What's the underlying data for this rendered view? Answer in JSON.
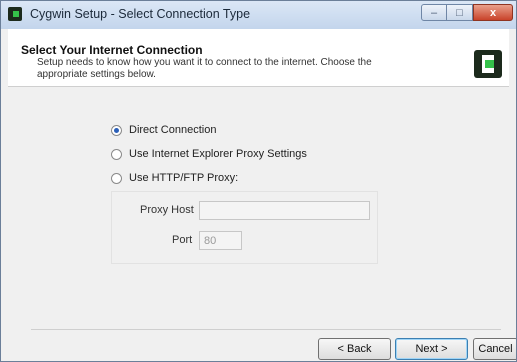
{
  "window": {
    "title": "Cygwin Setup - Select Connection Type",
    "controls": {
      "minimize": "–",
      "maximize": "□",
      "close": "x"
    }
  },
  "header": {
    "title": "Select Your Internet Connection",
    "description": "Setup needs to know how you want it to connect to the internet.  Choose the appropriate settings below."
  },
  "options": [
    {
      "label": "Direct Connection",
      "checked": true
    },
    {
      "label": "Use Internet Explorer Proxy Settings",
      "checked": false
    },
    {
      "label": "Use HTTP/FTP Proxy:",
      "checked": false
    }
  ],
  "proxy": {
    "host_label": "Proxy Host",
    "host_value": "",
    "port_label": "Port",
    "port_value": "80"
  },
  "buttons": {
    "back": "< Back",
    "next": "Next >",
    "cancel": "Cancel"
  },
  "colors": {
    "accent": "#35c24a",
    "radio_selected": "#2b5fb8"
  }
}
